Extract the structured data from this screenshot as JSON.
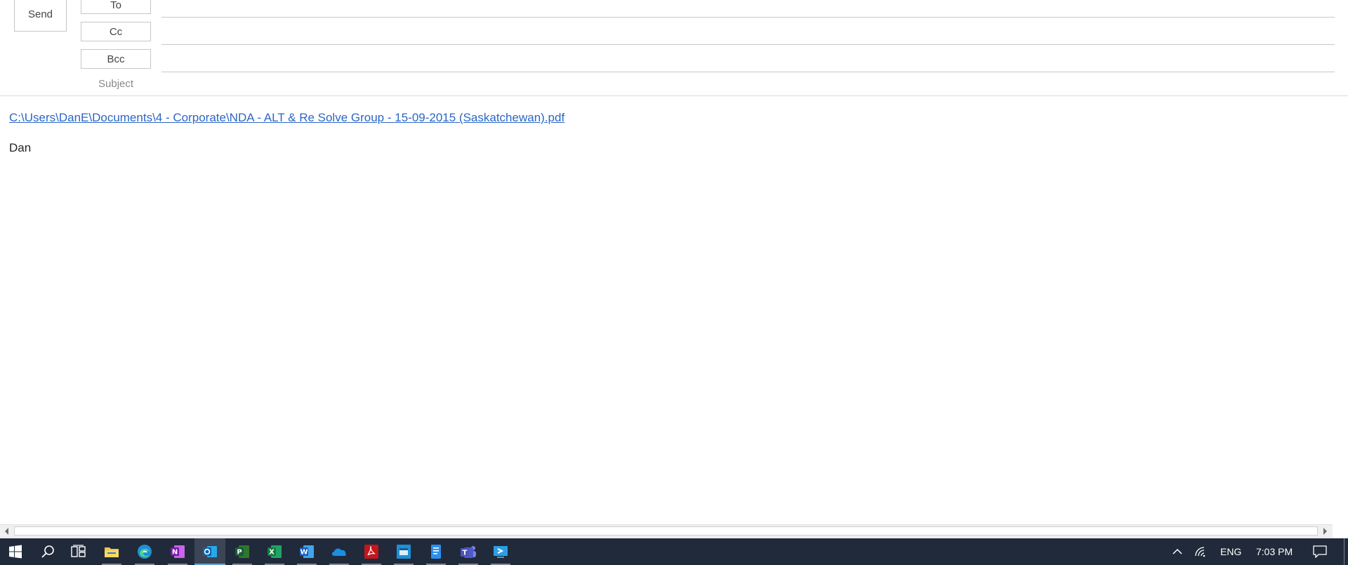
{
  "header": {
    "send_label": "Send",
    "to_label": "To",
    "cc_label": "Cc",
    "bcc_label": "Bcc",
    "subject_label": "Subject",
    "to_value": "",
    "cc_value": "",
    "bcc_value": "",
    "subject_value": ""
  },
  "body": {
    "attachment_link": "C:\\Users\\DanE\\Documents\\4 - Corporate\\NDA - ALT & Re Solve Group - 15-09-2015 (Saskatchewan).pdf",
    "signature": "Dan"
  },
  "colors": {
    "link": "#2b67c6",
    "taskbar": "#202a3a",
    "border": "#c6c6c6"
  },
  "taskbar": {
    "apps": [
      "windows-start-icon",
      "search-icon",
      "task-view-icon",
      "file-explorer-icon",
      "edge-icon",
      "onenote-icon",
      "outlook-icon",
      "project-icon",
      "excel-icon",
      "word-icon",
      "onedrive-icon",
      "acrobat-icon",
      "outlook-calendar-icon",
      "notes-icon",
      "teams-icon",
      "remote-desktop-icon"
    ],
    "active_app": "outlook-icon",
    "tray": {
      "language": "ENG",
      "time": "7:03 PM"
    }
  }
}
